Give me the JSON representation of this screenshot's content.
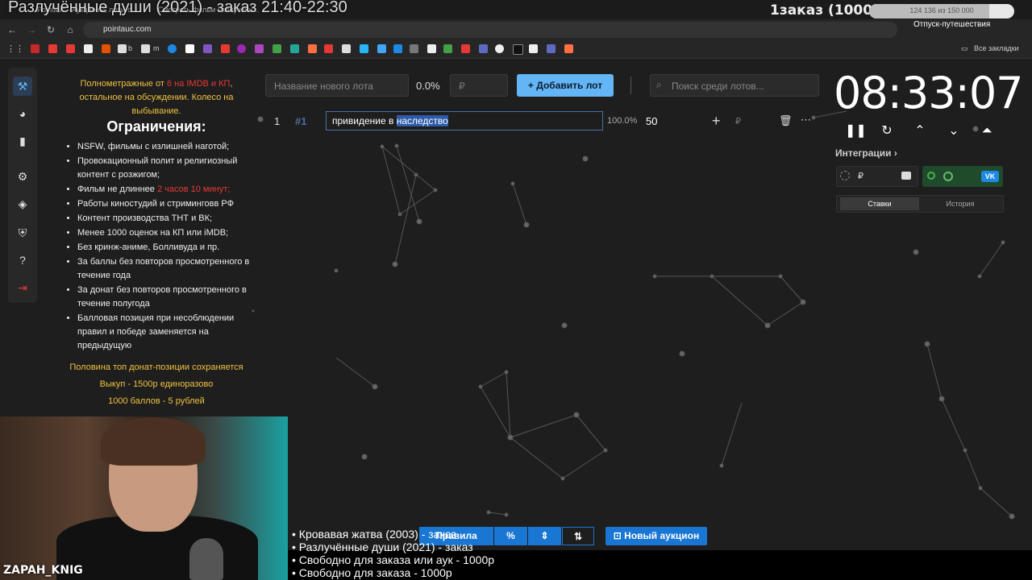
{
  "stream": {
    "title": "Разлучённые души (2021) - заказ 21:40-22:30",
    "order_label": "1заказ (1000р)",
    "progress_text": "124 136 из 150 000",
    "progress_fraction": 0.83,
    "vacation_text": "Отпуск-путешествия"
  },
  "browser": {
    "tabs": [
      "Pointauc - Аукционы, лоты с...",
      "Смотреть фильм Разлучённ..."
    ],
    "url": "pointauc.com",
    "all_bookmarks": "Все закладки",
    "bookmark_labels": [
      "b",
      "m"
    ]
  },
  "sidebar": {
    "icons": [
      "gavel-icon",
      "pie-chart-icon",
      "bar-chart-icon",
      "settings-icon",
      "layers-icon",
      "shield-icon",
      "help-icon",
      "logout-icon"
    ]
  },
  "rules": {
    "intro_pre": "Полнометражные от ",
    "intro_red": "6 на IMDB и КП",
    "intro_post": ", остальное на обсуждении. Колесо на выбывание.",
    "heading": "Ограничения:",
    "items": [
      "NSFW, фильмы с излишней наготой;",
      "Провокационный полит и религиозный контент с розжигом;",
      "Фильм не длиннее ",
      "Работы киностудий и стриминговв РФ",
      "Контент производства ТНТ и ВК;",
      "Менее 1000 оценок на КП или iMDB;",
      "Без кринж-аниме, Болливуда и пр.",
      "За баллы без повторов просмотренного в течение года",
      "За донат без повторов просмотренного в течение полугода",
      "Балловая позиция при несоблюдении правил и победе заменяется на предыдущую"
    ],
    "item3_red": "2 часов 10 минут;",
    "foot": [
      "Половина топ донат-позиции сохраняется",
      "Выкуп - 1500р единоразово",
      "1000 баллов - 5 рублей"
    ]
  },
  "controls": {
    "new_lot_placeholder": "Название нового лота",
    "percent": "0.0%",
    "currency": "₽",
    "add_lot": "Добавить лот",
    "search_placeholder": "Поиск среди лотов..."
  },
  "lot": {
    "index": "1",
    "tag": "#1",
    "name_pre": "привидение в ",
    "name_sel": "наследство",
    "percent": "100.0%",
    "amount": "50",
    "currency": "₽"
  },
  "timer": {
    "time": "08:33:07",
    "integrations": "Интеграции",
    "tab_bets": "Ставки",
    "tab_history": "История",
    "currency": "₽"
  },
  "webcam": {
    "label": "ZAPAH_KNIG"
  },
  "bottom": {
    "ticker": [
      "• Кровавая жатва (2003) - заказ",
      "• Разлучённые души (2021) - заказ",
      "• Свободно для заказа или аук - 1000р",
      "• Свободно для заказа - 1000р"
    ],
    "rules_btn": "Правила",
    "percent_btn": "%",
    "new_auction": "Новый аукцион"
  },
  "colors": {
    "accent": "#64b5f6",
    "bottom_blue": "#1976d2",
    "warning": "#f0c040",
    "danger": "#e53935"
  }
}
